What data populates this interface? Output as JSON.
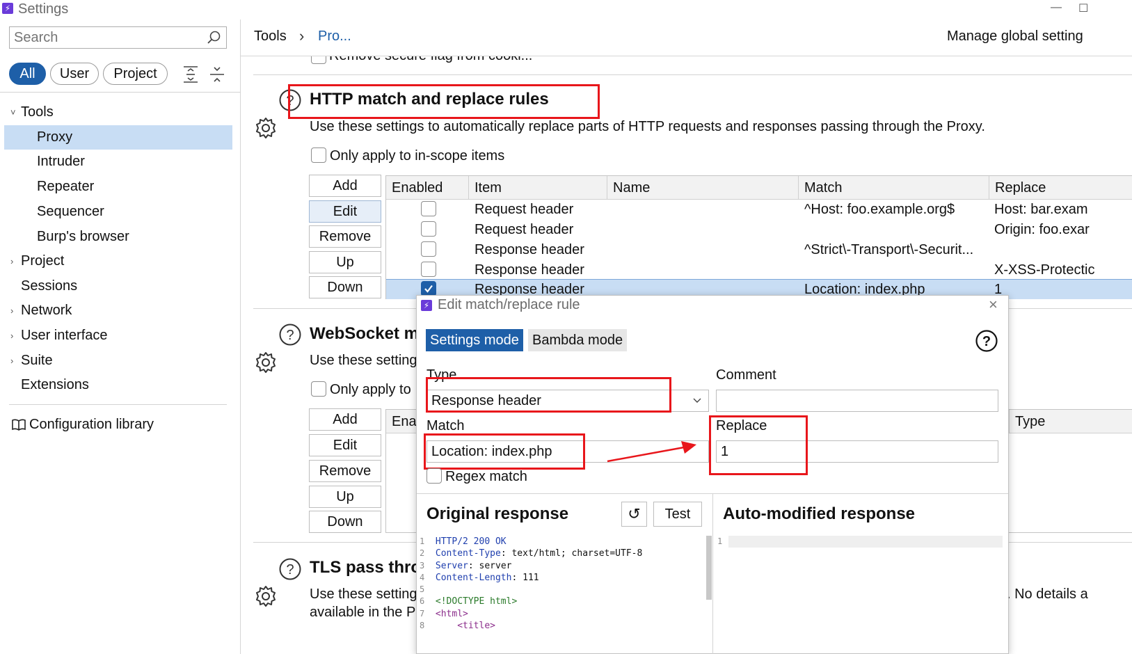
{
  "window": {
    "title": "Settings",
    "minimize_glyph": "—",
    "maximize_glyph": "☐"
  },
  "sidebar": {
    "search_placeholder": "Search",
    "filters": [
      {
        "label": "All",
        "active": true
      },
      {
        "label": "User",
        "active": false
      },
      {
        "label": "Project",
        "active": false
      }
    ],
    "tree": [
      {
        "label": "Tools",
        "chevron": "˅",
        "level": 0
      },
      {
        "label": "Proxy",
        "level": 1,
        "selected": true
      },
      {
        "label": "Intruder",
        "level": 1
      },
      {
        "label": "Repeater",
        "level": 1
      },
      {
        "label": "Sequencer",
        "level": 1
      },
      {
        "label": "Burp's browser",
        "level": 1
      },
      {
        "label": "Project",
        "chevron": "›",
        "level": 0
      },
      {
        "label": "Sessions",
        "level": 0
      },
      {
        "label": "Network",
        "chevron": "›",
        "level": 0
      },
      {
        "label": "User interface",
        "chevron": "›",
        "level": 0
      },
      {
        "label": "Suite",
        "chevron": "›",
        "level": 0
      },
      {
        "label": "Extensions",
        "level": 0
      }
    ],
    "config_library": "Configuration library",
    "accent": "#1e5fa8",
    "selected_bg": "#c8ddf4"
  },
  "header": {
    "breadcrumb_root": "Tools",
    "breadcrumb_sep": "›",
    "breadcrumb_current": "Pro...",
    "manage_link": "Manage global setting"
  },
  "partial_row": "Remove secure flag from cooki...",
  "http_section": {
    "title": "HTTP match and replace rules",
    "description": "Use these settings to automatically replace parts of HTTP requests and responses passing through the Proxy.",
    "scope_label": "Only apply to in-scope items",
    "buttons": [
      "Add",
      "Edit",
      "Remove",
      "Up",
      "Down"
    ],
    "columns": [
      "Enabled",
      "Item",
      "Name",
      "Match",
      "Replace"
    ],
    "rows": [
      {
        "enabled": false,
        "item": "Request header",
        "name": "",
        "match": "^Host: foo.example.org$",
        "replace": "Host: bar.exam"
      },
      {
        "enabled": false,
        "item": "Request header",
        "name": "",
        "match": "",
        "replace": "Origin: foo.exar"
      },
      {
        "enabled": false,
        "item": "Response header",
        "name": "",
        "match": "^Strict\\-Transport\\-Securit...",
        "replace": ""
      },
      {
        "enabled": false,
        "item": "Response header",
        "name": "",
        "match": "",
        "replace": "X-XSS-Protectic"
      },
      {
        "enabled": true,
        "item": "Response header",
        "name": "",
        "match": "Location: index.php",
        "replace": "1"
      }
    ]
  },
  "ws_section": {
    "title": "WebSocket m",
    "description": "Use these setting",
    "scope_label": "Only apply to",
    "buttons": [
      "Add",
      "Edit",
      "Remove",
      "Up",
      "Down"
    ],
    "col_enabled": "Enal",
    "col_type": "Type"
  },
  "tls_section": {
    "title": "TLS pass thro",
    "description_line1": "Use these setting",
    "description_tail": ". No details a",
    "description_line2": "available in the P"
  },
  "dialog": {
    "title": "Edit match/replace rule",
    "close_glyph": "×",
    "tabs": [
      {
        "label": "Settings mode",
        "active": true
      },
      {
        "label": "Bambda mode",
        "active": false
      }
    ],
    "help_glyph": "?",
    "type_label": "Type",
    "type_value": "Response header",
    "comment_label": "Comment",
    "comment_value": "",
    "match_label": "Match",
    "match_value": "Location: index.php",
    "replace_label": "Replace",
    "replace_value": "1",
    "regex_label": "Regex match",
    "original_title": "Original response",
    "reset_glyph": "↺",
    "test_label": "Test",
    "modified_title": "Auto-modified response",
    "original_lines": [
      {
        "n": "1",
        "key": "HTTP/2 200 OK",
        "val": ""
      },
      {
        "n": "2",
        "key": "Content-Type",
        "val": ": text/html; charset=UTF-8"
      },
      {
        "n": "3",
        "key": "Server",
        "val": ": server"
      },
      {
        "n": "4",
        "key": "Content-Length",
        "val": ": 111"
      },
      {
        "n": "5",
        "key": "",
        "val": ""
      },
      {
        "n": "6",
        "key": "<!DOCTYPE html>",
        "val": ""
      },
      {
        "n": "7",
        "key": "<html>",
        "val": ""
      },
      {
        "n": "8",
        "key": "    <title>",
        "val": ""
      }
    ],
    "modified_lines": [
      {
        "n": "1"
      }
    ]
  }
}
